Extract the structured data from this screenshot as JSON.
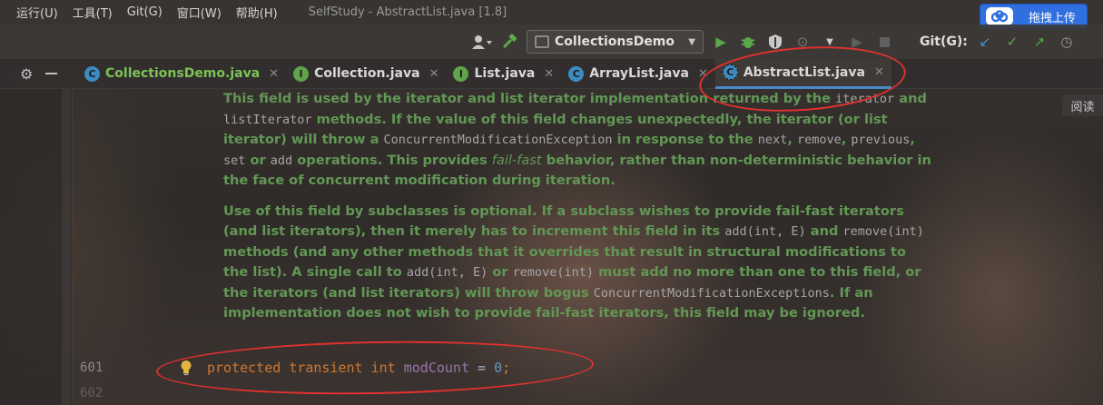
{
  "menubar": {
    "items": [
      "运行(U)",
      "工具(T)",
      "Git(G)",
      "窗口(W)",
      "帮助(H)"
    ],
    "window_title": "SelfStudy - AbstractList.java [1.8]"
  },
  "upload": {
    "label": "拖拽上传"
  },
  "toolbar": {
    "run_config": "CollectionsDemo",
    "git_label": "Git(G):"
  },
  "tabs": [
    {
      "label": "CollectionsDemo.java",
      "icon": "class-icon",
      "kind": "C"
    },
    {
      "label": "Collection.java",
      "icon": "interface-icon",
      "kind": "I"
    },
    {
      "label": "List.java",
      "icon": "interface-icon",
      "kind": "I"
    },
    {
      "label": "ArrayList.java",
      "icon": "class-icon",
      "kind": "C"
    },
    {
      "label": "AbstractList.java",
      "icon": "abstract-class-icon",
      "kind": "C",
      "active": true
    }
  ],
  "reader_mode": "阅读",
  "doc": {
    "p1": {
      "t1": "This field is used by the iterator and list iterator implementation returned by the ",
      "c1": "iterator",
      "t2": " and ",
      "c2": "listIterator",
      "t3": " methods. If the value of this field changes unexpectedly, the iterator (or list iterator) will throw a ",
      "c3": "ConcurrentModificationException",
      "t4": " in response to the ",
      "c4": "next",
      "t5": ", ",
      "c5": "remove",
      "t6": ", ",
      "c6": "previous",
      "t7": ", ",
      "c7": "set",
      "t8": " or ",
      "c8": "add",
      "t9": " operations. This provides ",
      "em": "fail-fast",
      "t10": " behavior, rather than non-deterministic behavior in the face of concurrent modification during iteration."
    },
    "p2": {
      "t1": "Use of this field by subclasses is optional. If a subclass wishes to provide fail-fast iterators (and list iterators), then it merely has to increment this field in its ",
      "c1": "add(int, E)",
      "t2": " and ",
      "c2": "remove(int)",
      "t3": " methods (and any other methods that it overrides that result in structural modifications to the list). A single call to ",
      "c3": "add(int, E)",
      "t4": " or ",
      "c4": "remove(int)",
      "t5": " must add no more than one to this field, or the iterators (and list iterators) will throw bogus ",
      "c5": "ConcurrentModificationExceptions",
      "t6": ". If an implementation does not wish to provide fail-fast iterators, this field may be ignored."
    }
  },
  "code": {
    "line601": {
      "num": "601",
      "kw1": "protected",
      "kw2": "transient",
      "kw3": "int",
      "field": "modCount",
      "eq": " = ",
      "val": "0",
      "semi": ";"
    },
    "line602": {
      "num": "602"
    }
  }
}
